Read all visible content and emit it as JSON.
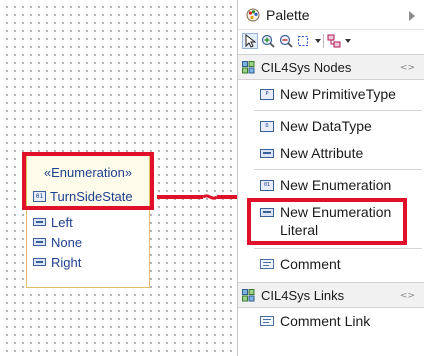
{
  "diagram": {
    "enumeration": {
      "stereotype": "«Enumeration»",
      "name": "TurnSideState",
      "icon": "enum-icon",
      "literals": [
        {
          "label": "Left",
          "icon": "literal-icon"
        },
        {
          "label": "None",
          "icon": "literal-icon"
        },
        {
          "label": "Right",
          "icon": "literal-icon"
        }
      ]
    },
    "highlight_color": "#e0102a"
  },
  "palette": {
    "title": "Palette",
    "title_icon": "palette-icon",
    "toolbar": [
      "select-tool-icon",
      "zoom-in-icon",
      "zoom-out-icon",
      "marquee-icon",
      "connection-icon"
    ],
    "drawers": [
      {
        "label": "CIL4Sys Nodes",
        "tools": [
          {
            "label": "New PrimitiveType",
            "icon": "primitive-type-icon"
          },
          {
            "label": "New DataType",
            "icon": "data-type-icon"
          },
          {
            "label": "New Attribute",
            "icon": "attribute-icon"
          },
          {
            "label": "New Enumeration",
            "icon": "enumeration-icon"
          },
          {
            "label": "New Enumeration Literal",
            "icon": "enumeration-literal-icon"
          },
          {
            "label": "Comment",
            "icon": "comment-icon"
          }
        ]
      },
      {
        "label": "CIL4Sys Links",
        "tools": [
          {
            "label": "Comment Link",
            "icon": "comment-link-icon"
          }
        ]
      }
    ]
  }
}
